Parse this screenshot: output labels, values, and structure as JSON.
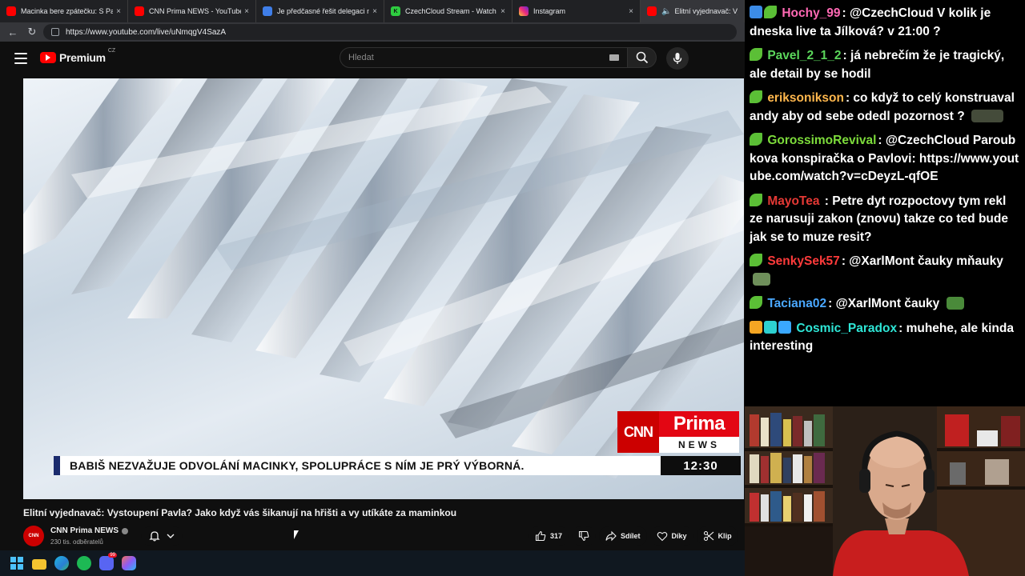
{
  "browser": {
    "tabs": [
      {
        "title": "Macinka bere zpátečku: S Pavlem",
        "favicon": "youtube-icon",
        "close": "×"
      },
      {
        "title": "CNN Prima NEWS - YouTube",
        "favicon": "youtube-icon",
        "close": "×"
      },
      {
        "title": "Je předčasné řešit delegaci na",
        "favicon": "document-icon",
        "close": "×"
      },
      {
        "title": "CzechCloud Stream - Watch Live o",
        "favicon": "kick-icon",
        "close": "×"
      },
      {
        "title": "Instagram",
        "favicon": "instagram-icon",
        "close": "×"
      },
      {
        "title": "Elitní vyjednavač: Vystou",
        "favicon": "youtube-icon",
        "close": ""
      }
    ],
    "url": "https://www.youtube.com/live/uNmqgV4SazA"
  },
  "youtube": {
    "brand": "Premium",
    "region": "CZ",
    "search_placeholder": "Hledat"
  },
  "video": {
    "ticker_headline": "BABIŠ NEZVAŽUJE ODVOLÁNÍ MACINKY, SPOLUPRÁCE S NÍM JE PRÝ VÝBORNÁ.",
    "ticker_time": "12:30",
    "logo_cnn": "CNN",
    "logo_prima": "Prima",
    "logo_news": "NEWS",
    "title": "Elitní vyjednavač: Vystoupení Pavla? Jako když vás šikanují na hřišti a vy utíkáte za maminkou",
    "channel_name": "CNN Prima NEWS",
    "channel_avatar_text": "CNN",
    "subscribers": "230 tis. odběratelů",
    "actions": {
      "likes": "317",
      "share": "Sdílet",
      "thanks": "Díky",
      "clip": "Klip"
    }
  },
  "chat": {
    "messages": [
      {
        "badges": [
          "blue",
          "leaf"
        ],
        "user": "Hochy_99",
        "user_color": "#ff69b4",
        "text": "@CzechCloud V kolik je dneska live ta Jílková? v 21:00 ?"
      },
      {
        "badges": [
          "leaf"
        ],
        "user": "Pavel_2_1_2",
        "user_color": "#5bd65b",
        "text": "já nebrečím že je tragický, ale detail by se hodil"
      },
      {
        "badges": [
          "leaf"
        ],
        "user": "eriksonikson",
        "user_color": "#ffb74d",
        "text": "co když to celý konstruaval andy aby od sebe odedl pozornost ?"
      },
      {
        "badges": [
          "leaf"
        ],
        "user": "GorossimoRevival",
        "user_color": "#7ddc3b",
        "text": "@CzechCloud Paroubkova konspiračka o Pavlovi: https://www.youtube.com/watch?v=cDeyzL-qfOE"
      },
      {
        "badges": [
          "leaf"
        ],
        "user": "MayoTea",
        "user_color": "#e53935",
        "text": "Petre dyt rozpoctovy tym rekl ze narusuji zakon (znovu) takze co ted bude jak se to muze resit?"
      },
      {
        "badges": [
          "leaf"
        ],
        "user": "SenkySek57",
        "user_color": "#ff3b3b",
        "text": "@XarlMont čauky mňauky"
      },
      {
        "badges": [
          "leaf"
        ],
        "user": "Taciana02",
        "user_color": "#4aa8ff",
        "text": "@XarlMont čauky"
      },
      {
        "badges": [
          "crown",
          "grid",
          "cube"
        ],
        "user": "Cosmic_Paradox",
        "user_color": "#2ee6d6",
        "text": "muhehe, ale kinda interesting"
      }
    ]
  }
}
